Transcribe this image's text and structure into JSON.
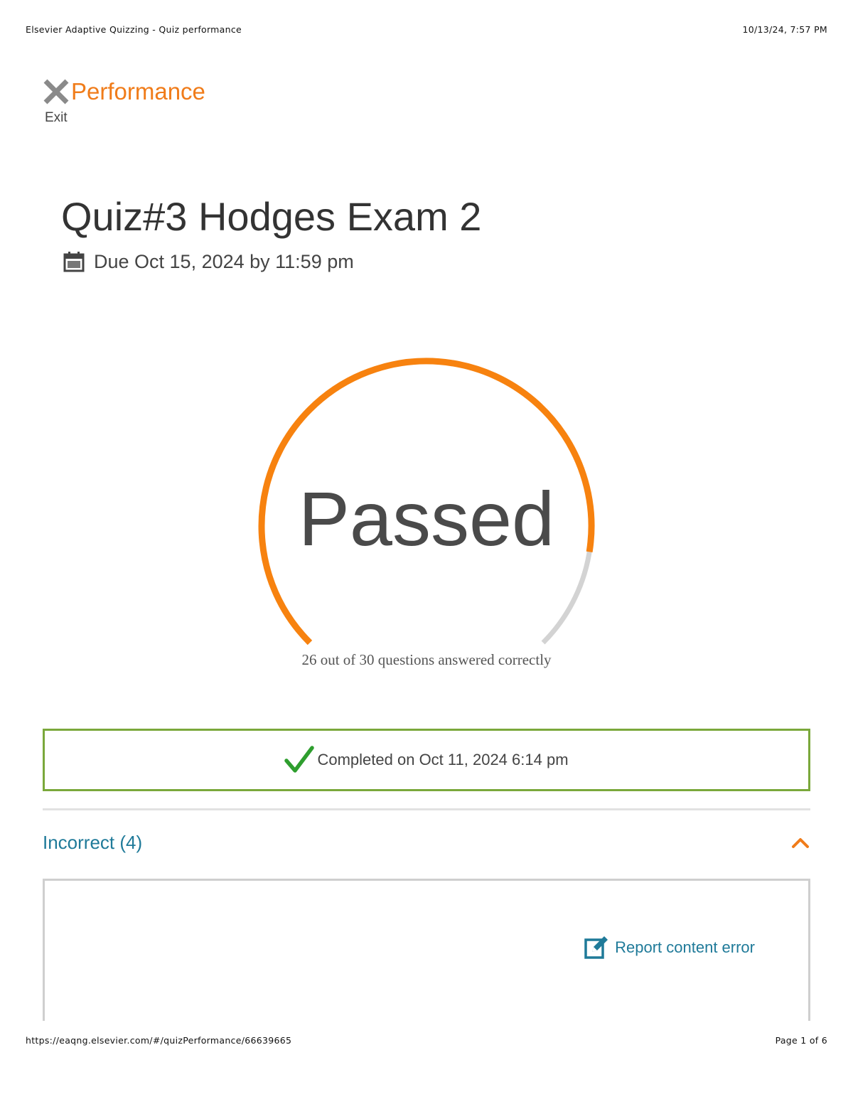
{
  "print_header": {
    "page_title": "Elsevier Adaptive Quizzing - Quiz performance",
    "datetime": "10/13/24, 7:57 PM"
  },
  "nav": {
    "title": "Performance",
    "exit_label": "Exit",
    "icon": "close-icon",
    "accent_color": "#f07c1a"
  },
  "quiz": {
    "title": "Quiz#3 Hodges Exam 2",
    "due_text": "Due Oct 15, 2024 by 11:59 pm",
    "due_icon": "calendar-icon"
  },
  "result": {
    "status": "Passed",
    "correct": 26,
    "total": 30,
    "caption": "26 out of 30 questions answered correctly",
    "progress_color": "#f7820f",
    "track_color": "#d3d3d3"
  },
  "completion": {
    "text": "Completed on Oct 11, 2024 6:14 pm",
    "icon": "check-icon",
    "border_color": "#7aa83b",
    "icon_color": "#2e9e2e"
  },
  "incorrect_section": {
    "title": "Incorrect (4)",
    "toggle_icon": "chevron-up-icon",
    "expanded": true
  },
  "question_panel": {
    "report_label": "Report content error",
    "report_icon": "edit-icon"
  },
  "print_footer": {
    "url": "https://eaqng.elsevier.com/#/quizPerformance/66639665",
    "page_info": "Page 1 of 6"
  }
}
